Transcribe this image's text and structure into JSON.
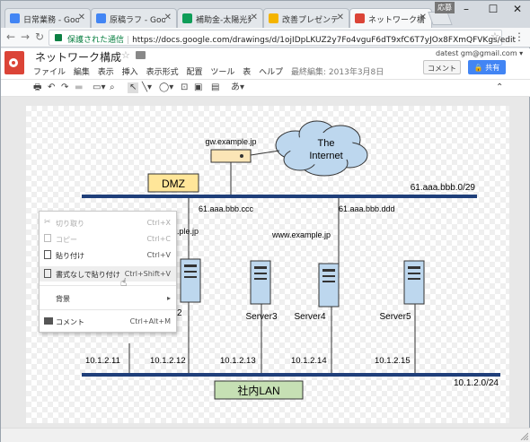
{
  "tabs": [
    {
      "title": "日常業務 - Google",
      "color": "#4285f4"
    },
    {
      "title": "原稿ラフ - Google",
      "color": "#4285f4"
    },
    {
      "title": "補助金-太陽光発電",
      "color": "#0f9d58"
    },
    {
      "title": "改善プレゼンテーショ",
      "color": "#f4b400"
    },
    {
      "title": "ネットワーク構成 - Go",
      "color": "#db4437"
    }
  ],
  "ext_label": "応募",
  "address": {
    "secure_label": "保護された通信",
    "url": "https://docs.google.com/drawings/d/1ojIDpLKUZ2y7Fo4vguF6dT9xfC6T7yJOx8FXmQFVKgs/edit"
  },
  "header": {
    "title": "ネットワーク構成",
    "menu": [
      "ファイル",
      "編集",
      "表示",
      "挿入",
      "表示形式",
      "配置",
      "ツール",
      "表",
      "ヘルプ"
    ],
    "last_edit": "最終編集: 2013年3月8日",
    "email": "datest gm@gmail.com ▾",
    "comment_label": "コメント",
    "share_label": "共有",
    "accent": "#4285f4"
  },
  "toolbar": {
    "font_label": "あ"
  },
  "diagram": {
    "router_label": "gw.example.jp",
    "cloud_line1": "The",
    "cloud_line2": "Internet",
    "dmz_label": "DMZ",
    "dmz_net": "61.aaa.bbb.0/29",
    "router_ip": "61.aaa.bbb.ccc",
    "web_ip": "61.aaa.bbb.ddd",
    "web_host": "www.example.jp",
    "partial_host": ".ple.jp",
    "lan_label": "社内LAN",
    "lan_net": "10.1.2.0/24",
    "servers": [
      "Server3",
      "Server4",
      "Server5"
    ],
    "server2_partial": "2",
    "ips": [
      "10.1.2.11",
      "10.1.2.12",
      "10.1.2.13",
      "10.1.2.14",
      "10.1.2.15"
    ],
    "bus_color": "#1f3f7a",
    "dmz_fill": "#ffe699",
    "lan_fill": "#c6e0b4",
    "cloud_fill": "#bdd7ee"
  },
  "context_menu": [
    {
      "label": "切り取り",
      "shortcut": "Ctrl+X",
      "disabled": true,
      "icon": "scissors-icon"
    },
    {
      "label": "コピー",
      "shortcut": "Ctrl+C",
      "disabled": true,
      "icon": "copy-icon"
    },
    {
      "label": "貼り付け",
      "shortcut": "Ctrl+V",
      "disabled": false,
      "icon": "paste-icon"
    },
    {
      "label": "書式なしで貼り付け",
      "shortcut": "Ctrl+Shift+V",
      "disabled": false,
      "icon": "paste-plain-icon"
    },
    {
      "label": "背景",
      "shortcut": "▸",
      "disabled": false,
      "icon": ""
    },
    {
      "label": "コメント",
      "shortcut": "Ctrl+Alt+M",
      "disabled": false,
      "icon": "comment-icon"
    }
  ]
}
